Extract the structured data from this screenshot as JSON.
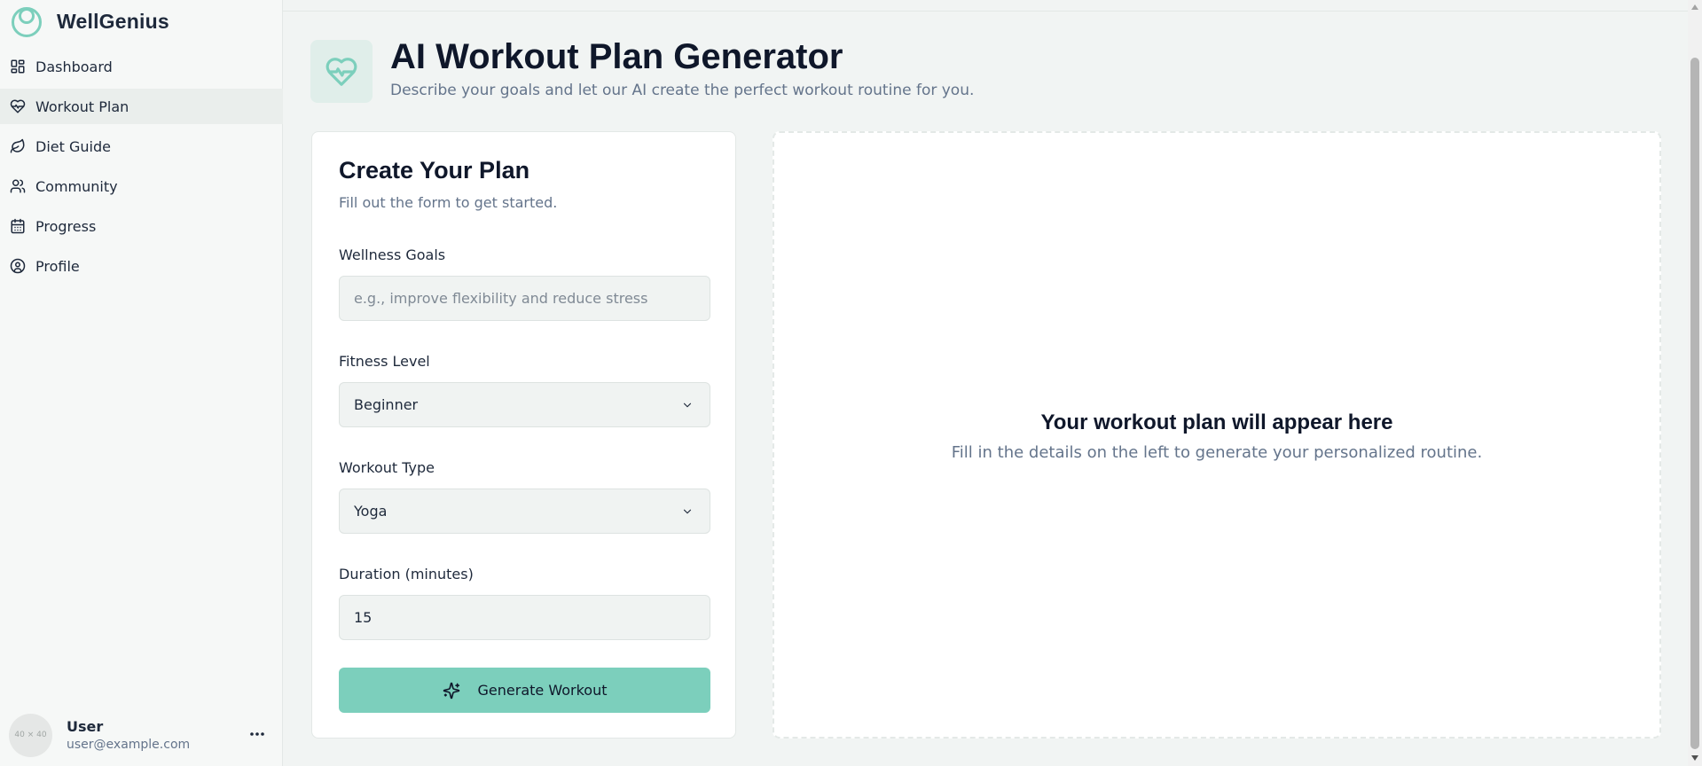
{
  "app": {
    "name": "WellGenius"
  },
  "sidebar": {
    "items": [
      {
        "label": "Dashboard",
        "icon": "dashboard-icon",
        "active": false
      },
      {
        "label": "Workout Plan",
        "icon": "heart-pulse-icon",
        "active": true
      },
      {
        "label": "Diet Guide",
        "icon": "leaf-icon",
        "active": false
      },
      {
        "label": "Community",
        "icon": "users-icon",
        "active": false
      },
      {
        "label": "Progress",
        "icon": "calendar-icon",
        "active": false
      },
      {
        "label": "Profile",
        "icon": "user-circle-icon",
        "active": false
      }
    ]
  },
  "user": {
    "avatar_text": "40 × 40",
    "name": "User",
    "email": "user@example.com",
    "menu_icon": "more-horizontal-icon"
  },
  "header": {
    "title": "AI Workout Plan Generator",
    "subtitle": "Describe your goals and let our AI create the perfect workout routine for you.",
    "icon": "heart-pulse-icon"
  },
  "form": {
    "title": "Create Your Plan",
    "description": "Fill out the form to get started.",
    "goals": {
      "label": "Wellness Goals",
      "placeholder": "e.g., improve flexibility and reduce stress",
      "value": ""
    },
    "fitness_level": {
      "label": "Fitness Level",
      "value": "Beginner"
    },
    "workout_type": {
      "label": "Workout Type",
      "value": "Yoga"
    },
    "duration": {
      "label": "Duration (minutes)",
      "value": "15"
    },
    "submit_label": "Generate Workout",
    "submit_icon": "sparkles-icon"
  },
  "result": {
    "title": "Your workout plan will appear here",
    "description": "Fill in the details on the left to generate your personalized routine."
  },
  "colors": {
    "accent": "#7ccfbc",
    "accent_light": "#e0eeea",
    "text": "#0f172a",
    "muted": "#64748b"
  }
}
